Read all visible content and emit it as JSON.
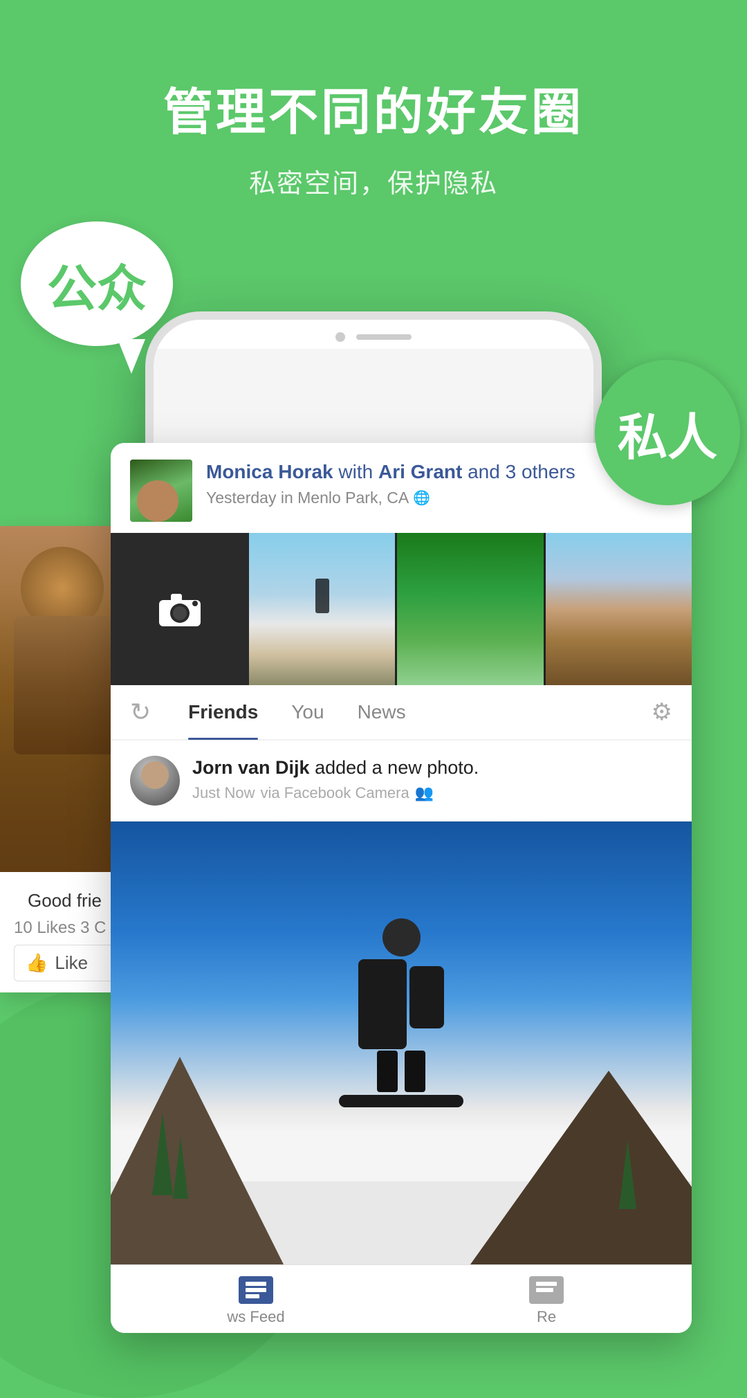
{
  "page": {
    "background_color": "#5bc86a"
  },
  "header": {
    "title": "管理不同的好友圈",
    "subtitle": "私密空间，保护隐私"
  },
  "bubbles": {
    "public_label": "公众",
    "private_label": "私人"
  },
  "post": {
    "author": "Monica Horak",
    "with_text": "with",
    "tagged": "Ari Grant",
    "others": "and 3 others",
    "location": "Yesterday in Menlo Park, CA",
    "preview_text": "Good frie"
  },
  "nav": {
    "refresh_label": "↻",
    "tabs": [
      {
        "label": "Friends",
        "active": true
      },
      {
        "label": "You",
        "active": false
      },
      {
        "label": "News",
        "active": false
      }
    ],
    "gear_label": "⚙"
  },
  "activity": {
    "author": "Jorn van Dijk",
    "action": "added a new photo.",
    "time": "Just Now",
    "via": "via Facebook Camera"
  },
  "post_stats": {
    "likes": "10 Likes",
    "comments": "3 C"
  },
  "like_button": {
    "label": "Like"
  },
  "bottom_nav": {
    "items": [
      {
        "label": "ws Feed"
      },
      {
        "label": "Re"
      }
    ]
  }
}
